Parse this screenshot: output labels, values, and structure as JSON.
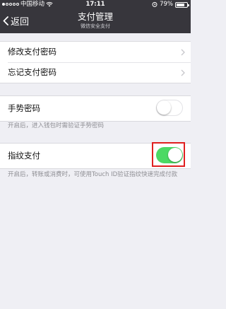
{
  "status_bar": {
    "carrier": "中国移动",
    "time": "17:11",
    "battery": "79%",
    "battery_level": 0.79,
    "signal_dots_filled": 1,
    "signal_dots_total": 5
  },
  "nav": {
    "back_label": "返回",
    "title": "支付管理",
    "subtitle": "微信安全支付"
  },
  "password_group": {
    "items": [
      {
        "label": "修改支付密码"
      },
      {
        "label": "忘记支付密码"
      }
    ]
  },
  "gesture": {
    "label": "手势密码",
    "enabled": false,
    "note": "开启后，进入钱包时需验证手势密码"
  },
  "fingerprint": {
    "label": "指纹支付",
    "enabled": true,
    "note": "开启后，转账或消费时，可使用Touch ID验证指纹快速完成付款"
  },
  "colors": {
    "nav_bg": "#37363c",
    "page_bg": "#efeff4",
    "toggle_on": "#4cd964",
    "highlight": "#e02020"
  }
}
